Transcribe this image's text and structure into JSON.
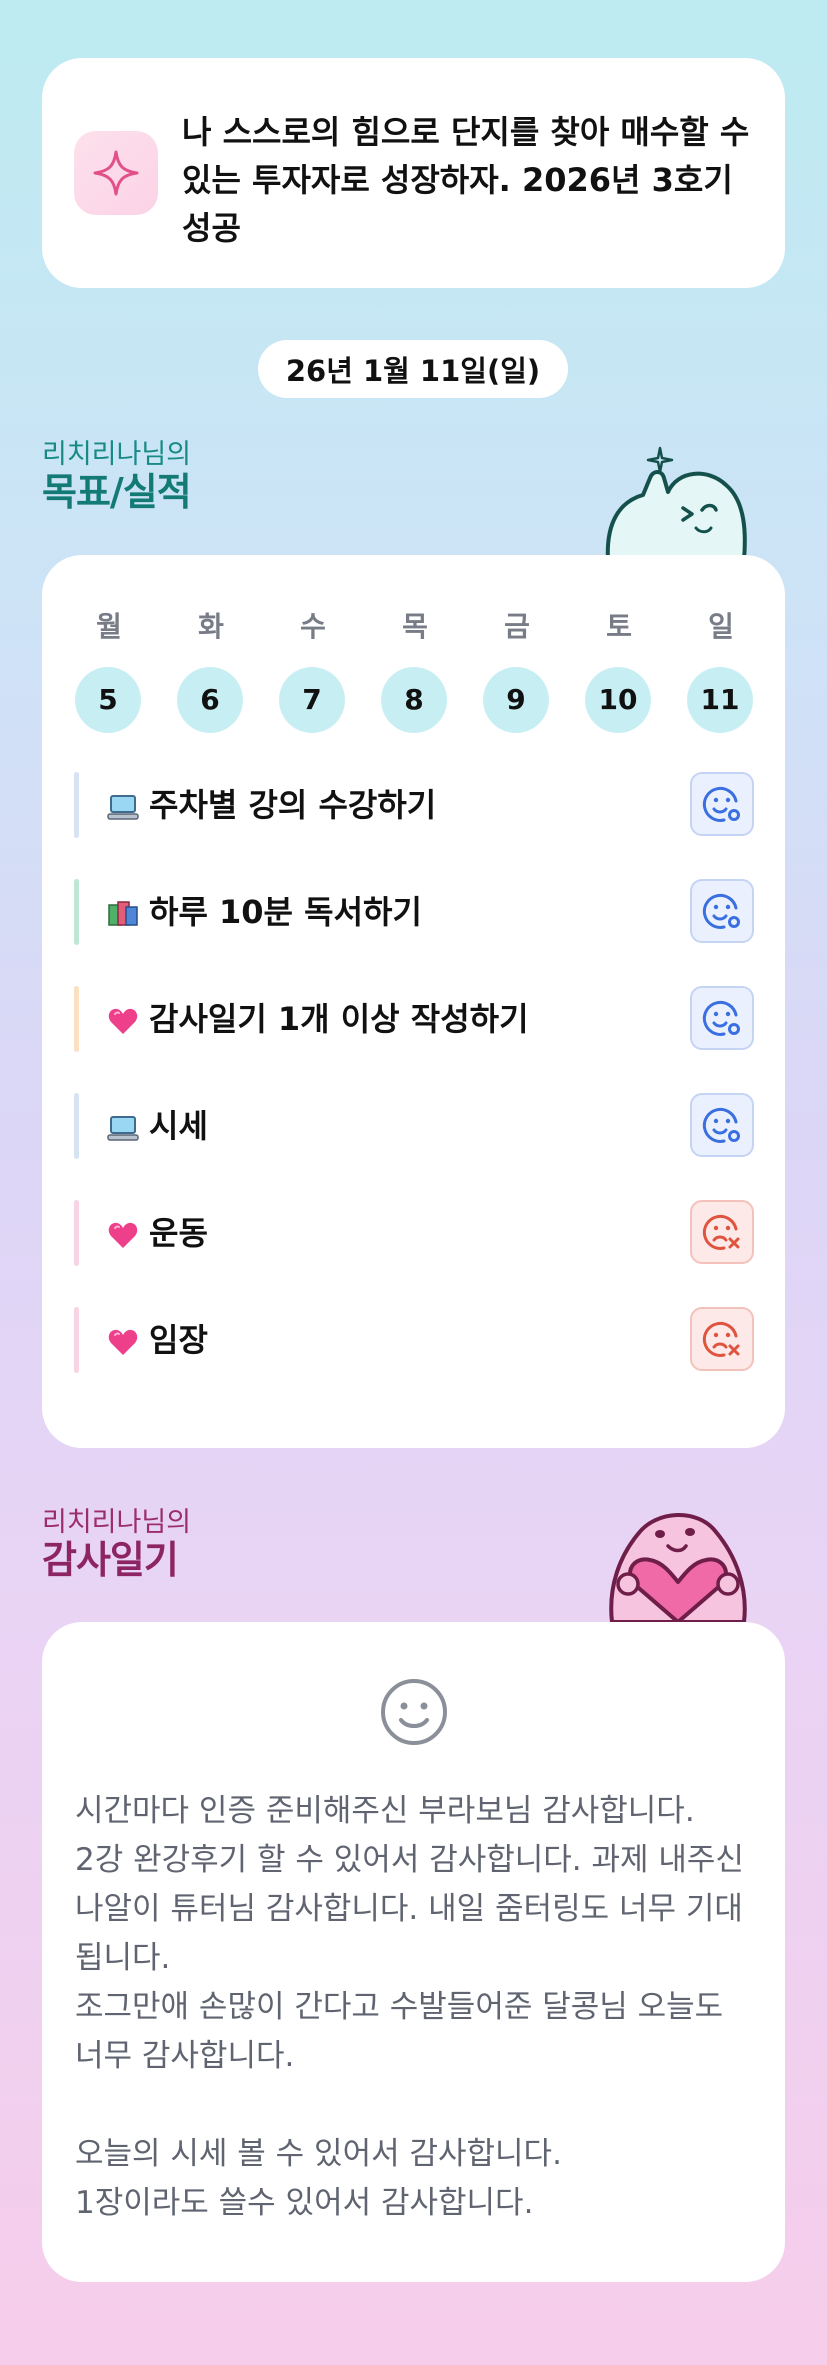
{
  "goal": {
    "text": "나 스스로의 힘으로 단지를 찾아 매수할 수 있는 투자자로 성장하자. 2026년 3호기성공",
    "icon": "sparkle-icon"
  },
  "date": "26년 1월 11일(일)",
  "goals_section": {
    "owner": "리치리나님의",
    "title": "목표/실적"
  },
  "week": [
    {
      "day": "월",
      "num": "5"
    },
    {
      "day": "화",
      "num": "6"
    },
    {
      "day": "수",
      "num": "7"
    },
    {
      "day": "목",
      "num": "8"
    },
    {
      "day": "금",
      "num": "9"
    },
    {
      "day": "토",
      "num": "10"
    },
    {
      "day": "일",
      "num": "11"
    }
  ],
  "tasks": [
    {
      "icon": "laptop-icon",
      "label": "주차별 강의 수강하기",
      "status": "done",
      "bar_color": "#d5e3f3"
    },
    {
      "icon": "books-icon",
      "label": "하루 10분 독서하기",
      "status": "done",
      "bar_color": "#bfe7d6"
    },
    {
      "icon": "heart-icon",
      "label": "감사일기 1개 이상 작성하기",
      "status": "done",
      "bar_color": "#fbe0c2"
    },
    {
      "icon": "laptop-icon",
      "label": "시세",
      "status": "done",
      "bar_color": "#d5e3f3"
    },
    {
      "icon": "heart-icon",
      "label": "운동",
      "status": "failed",
      "bar_color": "#f8d3e3"
    },
    {
      "icon": "heart-icon",
      "label": "임장",
      "status": "failed",
      "bar_color": "#f8d3e3"
    }
  ],
  "gratitude_section": {
    "owner": "리치리나님의",
    "title": "감사일기"
  },
  "gratitude": {
    "icon": "smile-icon",
    "text": "시간마다 인증 준비해주신 부라보님 감사합니다.\n2강 완강후기 할 수 있어서 감사합니다. 과제 내주신 나알이 튜터님 감사합니다. 내일 줌터링도 너무 기대됩니다.\n조그만애 손많이 간다고 수발들어준 달콩님 오늘도 너무 감사합니다.\n\n오늘의 시세 볼 수 있어서 감사합니다.\n1장이라도 쓸수 있어서 감사합니다."
  },
  "colors": {
    "accent_teal": "#137a76",
    "accent_plum": "#8d2564",
    "done_blue": "#3a6fe0",
    "fail_red": "#e0533f",
    "day_circle": "#c7eff3"
  }
}
